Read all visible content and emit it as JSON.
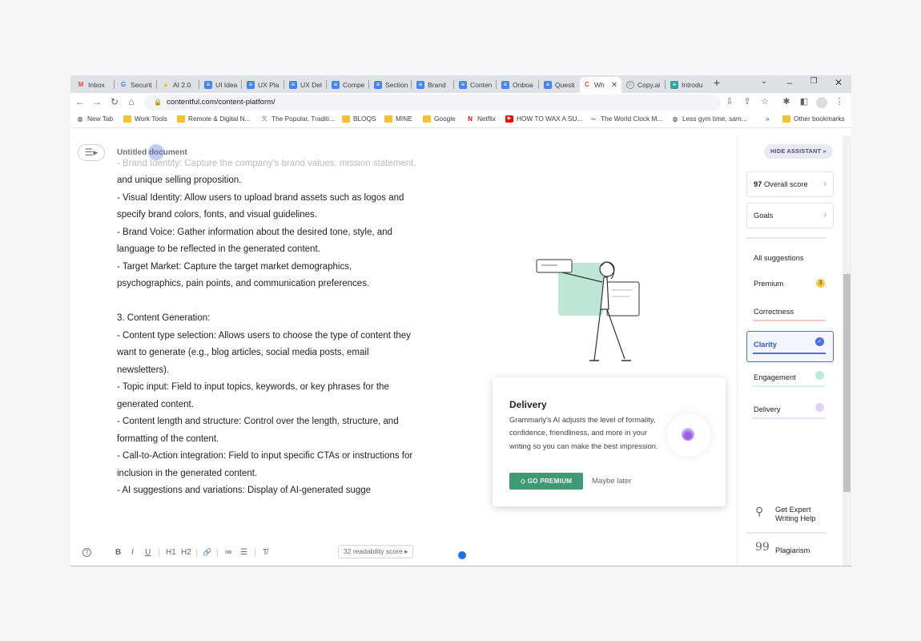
{
  "browser": {
    "tabs": [
      {
        "label": "Inbox",
        "icon": "gmail-icon",
        "color": "#ea4335"
      },
      {
        "label": "Securit",
        "icon": "google-icon",
        "color": "#4285f4"
      },
      {
        "label": "AI 2.0",
        "icon": "drive-icon",
        "color": "#fbbc04"
      },
      {
        "label": "UI Idea",
        "icon": "docs-icon",
        "color": "#4285f4"
      },
      {
        "label": "UX Pla",
        "icon": "docs-icon",
        "color": "#4285f4"
      },
      {
        "label": "UX Del",
        "icon": "docs-icon",
        "color": "#4285f4"
      },
      {
        "label": "Compe",
        "icon": "docs-icon",
        "color": "#4285f4"
      },
      {
        "label": "Section",
        "icon": "docs-icon",
        "color": "#4285f4"
      },
      {
        "label": "Brand",
        "icon": "docs-icon",
        "color": "#4285f4"
      },
      {
        "label": "Conten",
        "icon": "docs-icon",
        "color": "#4285f4"
      },
      {
        "label": "Onboa",
        "icon": "docs-icon",
        "color": "#4285f4"
      },
      {
        "label": "Questi",
        "icon": "docs-icon",
        "color": "#4285f4"
      },
      {
        "label": "Wh",
        "icon": "contentful-icon",
        "color": "#e84a2e"
      },
      {
        "label": "Copy.ai",
        "icon": "copyai-icon",
        "color": "#888888"
      },
      {
        "label": "Introdu",
        "icon": "docs-teal-icon",
        "color": "#2fa39a"
      }
    ],
    "new_tab": "+",
    "url": "contentful.com/content-platform/",
    "bookmarks": [
      {
        "label": "New Tab",
        "icon": "globe-icon"
      },
      {
        "label": "Work Tools",
        "icon": "folder-icon"
      },
      {
        "label": "Remote & Digital N...",
        "icon": "folder-icon"
      },
      {
        "label": "The Popular, Traditi...",
        "icon": "site-icon"
      },
      {
        "label": "BLOQS",
        "icon": "folder-icon"
      },
      {
        "label": "MINE",
        "icon": "folder-icon"
      },
      {
        "label": "Google",
        "icon": "folder-icon"
      },
      {
        "label": "Netflix",
        "icon": "netflix-icon"
      },
      {
        "label": "HOW TO WAX A SU...",
        "icon": "youtube-icon"
      },
      {
        "label": "The World Clock M...",
        "icon": "clock-icon"
      },
      {
        "label": "Less gym time, sam...",
        "icon": "globe-icon"
      }
    ],
    "bookmarks_more": "»",
    "other_bookmarks": "Other bookmarks"
  },
  "editor": {
    "doc_title": "Untitled document",
    "faded_line": "- Brand Identity: Capture the company's brand values, mission statement,",
    "lines": [
      "and unique selling proposition.",
      "- Visual Identity: Allow users to upload brand assets such as logos and",
      "specify brand colors, fonts, and visual guidelines.",
      "- Brand Voice: Gather information about the desired tone, style, and",
      "language to be reflected in the generated content.",
      "- Target Market: Capture the target market demographics,",
      "psychographics, pain points, and communication preferences.",
      "",
      "3. Content Generation:",
      "- Content type selection: Allows users to choose the type of content they",
      "want to generate (e.g., blog articles, social media posts, email",
      "newsletters).",
      "- Topic input: Field to input topics, keywords, or key phrases for the",
      "generated content.",
      "- Content length and structure: Control over the length, structure, and",
      "formatting of the content.",
      "- Call-to-Action integration: Field to input specific CTAs or instructions for",
      "inclusion in the generated content.",
      "- AI suggestions and variations: Display of AI-generated sugge"
    ],
    "toolbar": {
      "help": "?",
      "bold": "B",
      "italic": "I",
      "underline": "U",
      "h1": "H1",
      "h2": "H2",
      "link": "🔗",
      "ordered_list": "≔",
      "bullet_list": "☰",
      "clear_format": "T̸"
    },
    "readability": "32 readability score ▸"
  },
  "card": {
    "title": "Delivery",
    "description": "Grammarly's AI adjusts the level of formality, confidence, friendliness, and more in your writing so you can make the best impression.",
    "primary_button": "GO PREMIUM",
    "secondary_button": "Maybe later"
  },
  "assistant": {
    "hide_button": "HIDE ASSISTANT »",
    "overall_score_value": "97",
    "overall_score_label": "Overall score",
    "goals_label": "Goals",
    "all_suggestions": "All suggestions",
    "premium": "Premium",
    "premium_count": "3",
    "correctness": "Correctness",
    "clarity": "Clarity",
    "engagement": "Engagement",
    "delivery": "Delivery",
    "expert_help": "Get Expert Writing Help",
    "plagiarism": "Plagiarism",
    "colors": {
      "correctness": "#f5c6c6",
      "clarity": "#4a6fe3",
      "engagement": "#b9ecd8",
      "delivery": "#e3d2f7",
      "premium_badge": "#f7c948",
      "go_premium": "#3d9a72"
    }
  }
}
